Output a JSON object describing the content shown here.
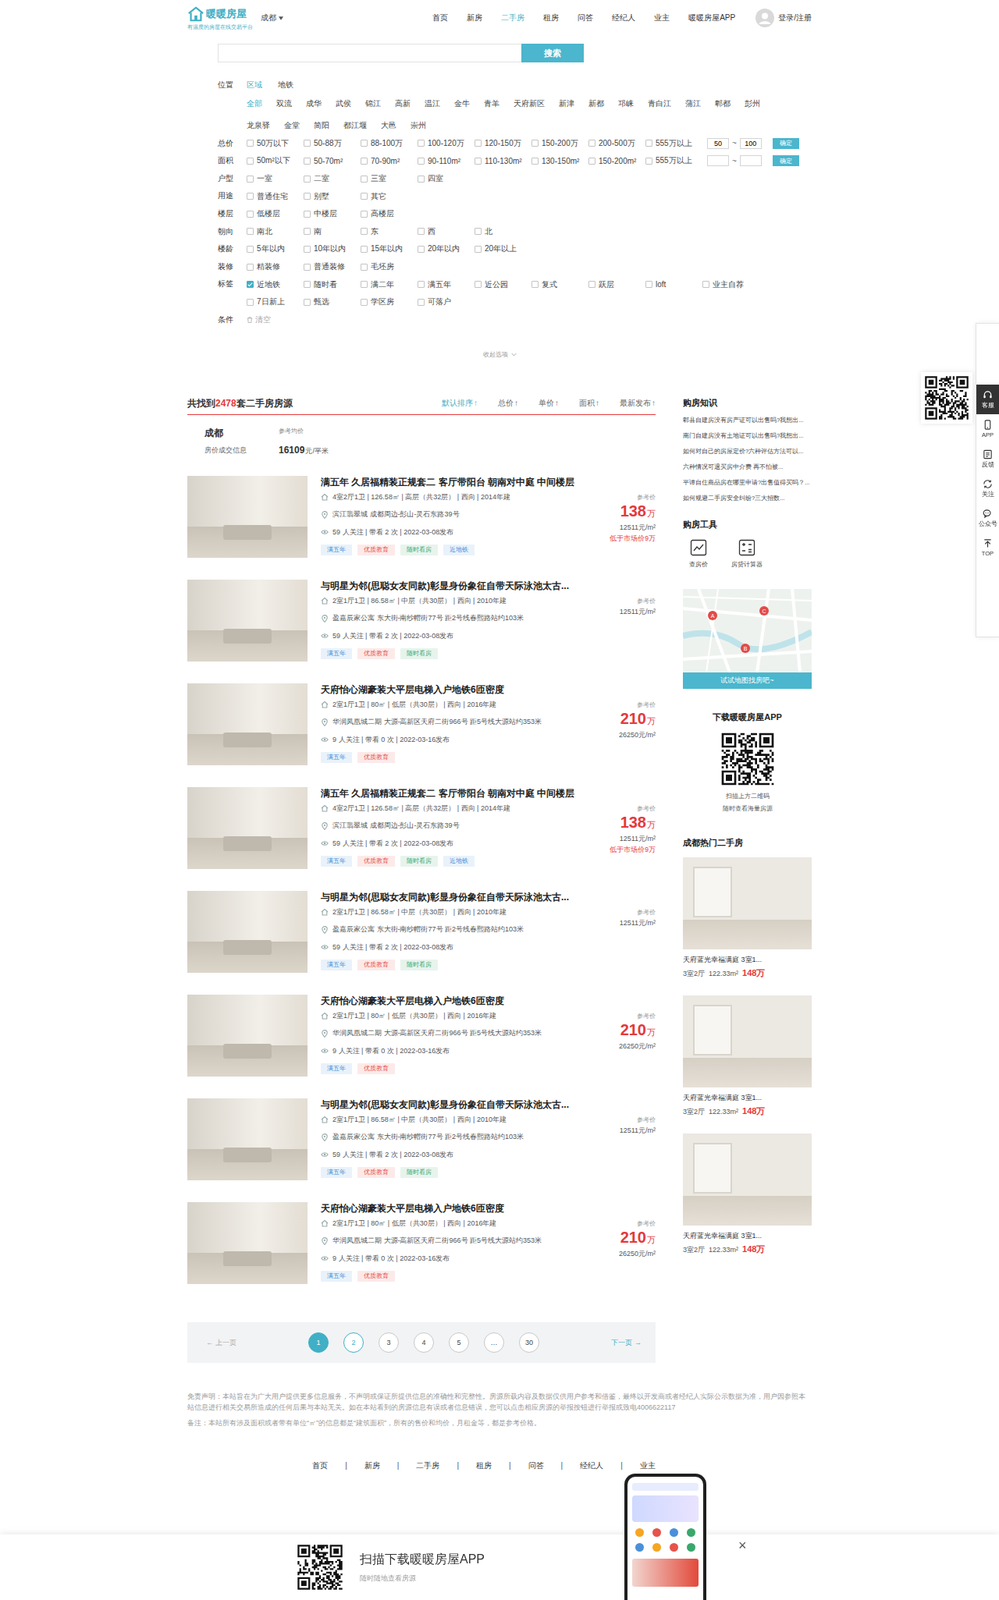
{
  "header": {
    "logo": "暖暖房屋",
    "slogan": "有温度的房屋在线交易平台",
    "city": "成都",
    "nav": [
      {
        "label": "首页",
        "selected": false
      },
      {
        "label": "新房",
        "selected": false
      },
      {
        "label": "二手房",
        "selected": true
      },
      {
        "label": "租房",
        "selected": false
      },
      {
        "label": "问答",
        "selected": false
      },
      {
        "label": "经纪人",
        "selected": false
      },
      {
        "label": "业主",
        "selected": false
      },
      {
        "label": "暖暖房屋APP",
        "selected": false
      }
    ],
    "login": "登录/注册"
  },
  "search": {
    "value": "",
    "button": "搜索"
  },
  "filters": {
    "location": {
      "label": "位置",
      "tabs": [
        {
          "label": "区域",
          "selected": true
        },
        {
          "label": "地铁",
          "selected": false
        }
      ],
      "districts": [
        {
          "label": "全部",
          "selected": true
        },
        {
          "label": "双流",
          "selected": false
        },
        {
          "label": "成华",
          "selected": false
        },
        {
          "label": "武侯",
          "selected": false
        },
        {
          "label": "锦江",
          "selected": false
        },
        {
          "label": "高新",
          "selected": false
        },
        {
          "label": "温江",
          "selected": false
        },
        {
          "label": "金牛",
          "selected": false
        },
        {
          "label": "青羊",
          "selected": false
        },
        {
          "label": "天府新区",
          "selected": false
        },
        {
          "label": "新津",
          "selected": false
        },
        {
          "label": "新都",
          "selected": false
        },
        {
          "label": "邛崃",
          "selected": false
        },
        {
          "label": "青白江",
          "selected": false
        },
        {
          "label": "蒲江",
          "selected": false
        },
        {
          "label": "郫都",
          "selected": false
        },
        {
          "label": "彭州",
          "selected": false
        },
        {
          "label": "龙泉驿",
          "selected": false
        },
        {
          "label": "金堂",
          "selected": false
        },
        {
          "label": "简阳",
          "selected": false
        },
        {
          "label": "都江堰",
          "selected": false
        },
        {
          "label": "大邑",
          "selected": false
        },
        {
          "label": "崇州",
          "selected": false
        }
      ]
    },
    "rows": [
      {
        "label": "总价",
        "options": [
          {
            "label": "50万以下",
            "checked": false
          },
          {
            "label": "50-88万",
            "checked": false
          },
          {
            "label": "88-100万",
            "checked": false
          },
          {
            "label": "100-120万",
            "checked": false
          },
          {
            "label": "120-150万",
            "checked": false
          },
          {
            "label": "150-200万",
            "checked": false
          },
          {
            "label": "200-500万",
            "checked": false
          },
          {
            "label": "555万以上",
            "checked": false
          }
        ],
        "range": {
          "min": "50",
          "sep": "~",
          "max": "100",
          "button": "确定"
        }
      },
      {
        "label": "面积",
        "options": [
          {
            "label": "50m²以下",
            "checked": false
          },
          {
            "label": "50-70m²",
            "checked": false
          },
          {
            "label": "70-90m²",
            "checked": false
          },
          {
            "label": "90-110m²",
            "checked": false
          },
          {
            "label": "110-130m²",
            "checked": false
          },
          {
            "label": "130-150m²",
            "checked": false
          },
          {
            "label": "150-200m²",
            "checked": false
          },
          {
            "label": "555万以上",
            "checked": false
          }
        ],
        "range": {
          "min": "",
          "sep": "~",
          "max": "",
          "button": "确定"
        }
      },
      {
        "label": "户型",
        "options": [
          {
            "label": "一室",
            "checked": false
          },
          {
            "label": "二室",
            "checked": false
          },
          {
            "label": "三室",
            "checked": false
          },
          {
            "label": "四室",
            "checked": false
          }
        ]
      },
      {
        "label": "用途",
        "options": [
          {
            "label": "普通住宅",
            "checked": false
          },
          {
            "label": "别墅",
            "checked": false
          },
          {
            "label": "其它",
            "checked": false
          }
        ]
      },
      {
        "label": "楼层",
        "options": [
          {
            "label": "低楼层",
            "checked": false
          },
          {
            "label": "中楼层",
            "checked": false
          },
          {
            "label": "高楼层",
            "checked": false
          }
        ]
      },
      {
        "label": "朝向",
        "options": [
          {
            "label": "南北",
            "checked": false
          },
          {
            "label": "南",
            "checked": false
          },
          {
            "label": "东",
            "checked": false
          },
          {
            "label": "西",
            "checked": false
          },
          {
            "label": "北",
            "checked": false
          }
        ]
      },
      {
        "label": "楼龄",
        "options": [
          {
            "label": "5年以内",
            "checked": false
          },
          {
            "label": "10年以内",
            "checked": false
          },
          {
            "label": "15年以内",
            "checked": false
          },
          {
            "label": "20年以内",
            "checked": false
          },
          {
            "label": "20年以上",
            "checked": false
          }
        ]
      },
      {
        "label": "装修",
        "options": [
          {
            "label": "精装修",
            "checked": false
          },
          {
            "label": "普通装修",
            "checked": false
          },
          {
            "label": "毛坯房",
            "checked": false
          }
        ]
      },
      {
        "label": "标签",
        "options": [
          {
            "label": "近地铁",
            "checked": true
          },
          {
            "label": "随时看",
            "checked": false
          },
          {
            "label": "满二年",
            "checked": false
          },
          {
            "label": "满五年",
            "checked": false
          },
          {
            "label": "近公园",
            "checked": false
          },
          {
            "label": "复式",
            "checked": false
          },
          {
            "label": "跃层",
            "checked": false
          },
          {
            "label": "loft",
            "checked": false
          },
          {
            "label": "业主自荐",
            "checked": false
          },
          {
            "label": "7日新上",
            "checked": false
          },
          {
            "label": "甄选",
            "checked": false
          },
          {
            "label": "学区房",
            "checked": false
          },
          {
            "label": "可落户",
            "checked": false
          }
        ]
      }
    ],
    "condition": {
      "label": "条件",
      "clear": "清空"
    },
    "collapse": "收起选项"
  },
  "results": {
    "prefix": "共找到",
    "count": "2478",
    "suffix": "套二手房房源",
    "sorts": [
      {
        "label": "默认排序",
        "arrow": "↑",
        "selected": true
      },
      {
        "label": "总价",
        "arrow": "↑",
        "selected": false
      },
      {
        "label": "单价",
        "arrow": "↑",
        "selected": false
      },
      {
        "label": "面积",
        "arrow": "↑",
        "selected": false
      },
      {
        "label": "最新发布",
        "arrow": "↑",
        "selected": false
      }
    ]
  },
  "summary": {
    "city": "成都",
    "subtitle": "房价成交信息",
    "avgLabel": "参考均价",
    "avg": "16109",
    "avgUnit": "元/平米"
  },
  "listings": [
    {
      "title": "满五年 久居福精装正规套二 客厅带阳台 朝南对中庭 中间楼层",
      "specs": "4室2厅1卫 | 126.58㎡ | 高层（共32层） | 西向 | 2014年建",
      "community": "滨江翡翠城 成都周边-彭山-灵石东路39号",
      "meta": "59 人关注 | 带看 2 次 | 2022-03-08发布",
      "tags": [
        {
          "text": "满五年",
          "color": "#4a90d9"
        },
        {
          "text": "优质教育",
          "color": "#e5534b"
        },
        {
          "text": "随时看房",
          "color": "#3aa76d"
        },
        {
          "text": "近地铁",
          "color": "#4a90d9"
        }
      ],
      "priceLabel": "参考价",
      "price": "138",
      "priceUnit": "万",
      "unitPrice": "12511元/m²",
      "note": "低于市场价9万"
    },
    {
      "title": "与明星为邻(思聪女友同款)彰显身份象征自带天际泳池太古...",
      "specs": "2室1厅1卫 | 86.58㎡ | 中层（共30层） | 西向 | 2010年建",
      "community": "盈嘉辰家公寓 东大街-南纱帽街77号 距2号线春熙路站约103米",
      "meta": "59 人关注 | 带看 2 次 | 2022-03-08发布",
      "tags": [
        {
          "text": "满五年",
          "color": "#4a90d9"
        },
        {
          "text": "优质教育",
          "color": "#e5534b"
        },
        {
          "text": "随时看房",
          "color": "#3aa76d"
        }
      ],
      "priceLabel": "参考价",
      "unitPrice": "12511元/m²"
    },
    {
      "title": "天府怡心湖豪装大平层电梯入户地铁6匝密度",
      "specs": "2室1厅1卫 | 80㎡ | 低层（共30层） | 西向 | 2016年建",
      "community": "华润凤凰城二期 大源-高新区天府二街966号 距5号线大源站约353米",
      "meta": "9 人关注 | 带看 0 次 | 2022-03-16发布",
      "tags": [
        {
          "text": "满五年",
          "color": "#4a90d9"
        },
        {
          "text": "优质教育",
          "color": "#e5534b"
        }
      ],
      "priceLabel": "参考价",
      "price": "210",
      "priceUnit": "万",
      "unitPrice": "26250元/m²"
    },
    {
      "title": "满五年 久居福精装正规套二 客厅带阳台 朝南对中庭 中间楼层",
      "specs": "4室2厅1卫 | 126.58㎡ | 高层（共32层） | 西向 | 2014年建",
      "community": "滨江翡翠城 成都周边-彭山-灵石东路39号",
      "meta": "59 人关注 | 带看 2 次 | 2022-03-08发布",
      "tags": [
        {
          "text": "满五年",
          "color": "#4a90d9"
        },
        {
          "text": "优质教育",
          "color": "#e5534b"
        },
        {
          "text": "随时看房",
          "color": "#3aa76d"
        },
        {
          "text": "近地铁",
          "color": "#4a90d9"
        }
      ],
      "priceLabel": "参考价",
      "price": "138",
      "priceUnit": "万",
      "unitPrice": "12511元/m²",
      "note": "低于市场价9万"
    },
    {
      "title": "与明星为邻(思聪女友同款)彰显身份象征自带天际泳池太古...",
      "specs": "2室1厅1卫 | 86.58㎡ | 中层（共30层） | 西向 | 2010年建",
      "community": "盈嘉辰家公寓 东大街-南纱帽街77号 距2号线春熙路站约103米",
      "meta": "59 人关注 | 带看 2 次 | 2022-03-08发布",
      "tags": [
        {
          "text": "满五年",
          "color": "#4a90d9"
        },
        {
          "text": "优质教育",
          "color": "#e5534b"
        },
        {
          "text": "随时看房",
          "color": "#3aa76d"
        }
      ],
      "priceLabel": "参考价",
      "unitPrice": "12511元/m²"
    },
    {
      "title": "天府怡心湖豪装大平层电梯入户地铁6匝密度",
      "specs": "2室1厅1卫 | 80㎡ | 低层（共30层） | 西向 | 2016年建",
      "community": "华润凤凰城二期 大源-高新区天府二街966号 距5号线大源站约353米",
      "meta": "9 人关注 | 带看 0 次 | 2022-03-16发布",
      "tags": [
        {
          "text": "满五年",
          "color": "#4a90d9"
        },
        {
          "text": "优质教育",
          "color": "#e5534b"
        }
      ],
      "priceLabel": "参考价",
      "price": "210",
      "priceUnit": "万",
      "unitPrice": "26250元/m²"
    },
    {
      "title": "与明星为邻(思聪女友同款)彰显身份象征自带天际泳池太古...",
      "specs": "2室1厅1卫 | 86.58㎡ | 中层（共30层） | 西向 | 2010年建",
      "community": "盈嘉辰家公寓 东大街-南纱帽街77号 距2号线春熙路站约103米",
      "meta": "59 人关注 | 带看 2 次 | 2022-03-08发布",
      "tags": [
        {
          "text": "满五年",
          "color": "#4a90d9"
        },
        {
          "text": "优质教育",
          "color": "#e5534b"
        },
        {
          "text": "随时看房",
          "color": "#3aa76d"
        }
      ],
      "priceLabel": "参考价",
      "unitPrice": "12511元/m²"
    },
    {
      "title": "天府怡心湖豪装大平层电梯入户地铁6匝密度",
      "specs": "2室1厅1卫 | 80㎡ | 低层（共30层） | 西向 | 2016年建",
      "community": "华润凤凰城二期 大源-高新区天府二街966号 距5号线大源站约353米",
      "meta": "9 人关注 | 带看 0 次 | 2022-03-16发布",
      "tags": [
        {
          "text": "满五年",
          "color": "#4a90d9"
        },
        {
          "text": "优质教育",
          "color": "#e5534b"
        }
      ],
      "priceLabel": "参考价",
      "price": "210",
      "priceUnit": "万",
      "unitPrice": "26250元/m²"
    }
  ],
  "pagination": {
    "prevIcon": "←",
    "prev": "上一页",
    "next": "下一页",
    "nextIcon": "→",
    "pages": [
      {
        "label": "1",
        "selected": true,
        "hover": false
      },
      {
        "label": "2",
        "selected": false,
        "hover": true
      },
      {
        "label": "3",
        "selected": false,
        "hover": false
      },
      {
        "label": "4",
        "selected": false,
        "hover": false
      },
      {
        "label": "5",
        "selected": false,
        "hover": false
      },
      {
        "label": "…",
        "selected": false,
        "hover": false
      },
      {
        "label": "30",
        "selected": false,
        "hover": false
      }
    ]
  },
  "sidebar": {
    "knowledge": {
      "title": "购房知识",
      "items": [
        "郫县自建房没有房产证可以出售吗?我想出...",
        "南门自建房没有土地证可以出售吗?我想出...",
        "如何对自己的房屋定价?六种评估方法可以...",
        "六种情况可退买房中介费 再不怕被...",
        "平谭自住商品房在哪里申请?出售值得买吗？...",
        "如何规避二手房安全纠纷?三大招数..."
      ]
    },
    "tools": {
      "title": "购房工具",
      "items": [
        {
          "label": "查房价",
          "kind": "price"
        },
        {
          "label": "房贷计算器",
          "kind": "calculator"
        }
      ]
    },
    "map": {
      "button": "试试地图找房吧~",
      "pins": [
        "A",
        "C",
        "B"
      ]
    },
    "app": {
      "title": "下载暖暖房屋APP",
      "lines": [
        "扫描上方二维码",
        "随时查看海量房源"
      ]
    },
    "hot": {
      "title": "成都热门二手房",
      "items": [
        {
          "name": "天府蓝光幸福满庭 3室1...",
          "layout": "3室2厅",
          "area": "122.33m²",
          "price": "148",
          "unit": "万"
        },
        {
          "name": "天府蓝光幸福满庭 3室1...",
          "layout": "3室2厅",
          "area": "122.33m²",
          "price": "148",
          "unit": "万"
        },
        {
          "name": "天府蓝光幸福满庭 3室1...",
          "layout": "3室2厅",
          "area": "122.33m²",
          "price": "148",
          "unit": "万"
        }
      ]
    }
  },
  "disclaimer": {
    "text": "免责声明：本站旨在为广大用户提供更多信息服务，不声明或保证所提供信息的准确性和完整性。房源所载内容及数据仅供用户参考和借鉴，最终以开发商或者经纪人实际公示数据为准，用户因参照本站信息进行相关交易所造成的任何后果与本站无关。如在本站看到的房源信息有误或者信息错误，您可以点击相应房源的举报按钮进行举报或致电4006622117",
    "note": "备注：本站所有涉及面积或者带有单位“㎡”的信息都是“建筑面积”，所有的售价和均价，月租金等，都是参考价格。"
  },
  "footer": {
    "separator": "|",
    "links": [
      "首页",
      "新房",
      "二手房",
      "租房",
      "问答",
      "经纪人",
      "业主"
    ]
  },
  "toolbar": {
    "items": [
      {
        "label": "客服",
        "kind": "service",
        "selected": true
      },
      {
        "label": "APP",
        "kind": "app",
        "selected": false
      },
      {
        "label": "反馈",
        "kind": "feedback",
        "selected": false
      },
      {
        "label": "关注",
        "kind": "follow",
        "selected": false
      },
      {
        "label": "公众号",
        "kind": "wechat",
        "selected": false
      },
      {
        "label": "TOP",
        "kind": "top",
        "selected": false
      }
    ]
  },
  "banner": {
    "title": "扫描下载暖暖房屋APP",
    "subtitle": "随时随地查看房源",
    "close": "×"
  }
}
